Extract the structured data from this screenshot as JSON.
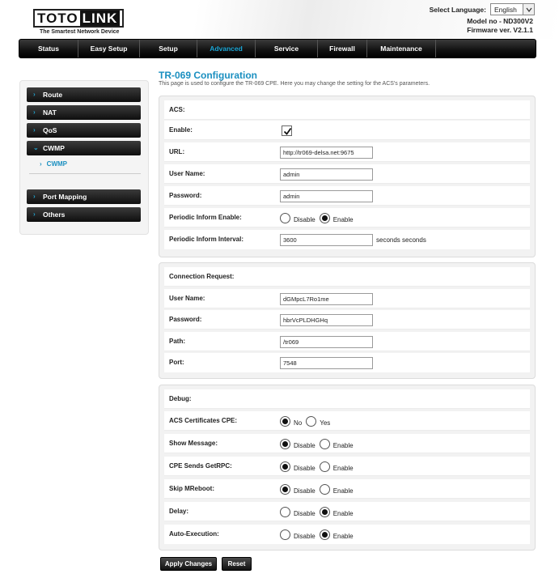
{
  "header": {
    "logo_left": "TOTO",
    "logo_right": "LINK",
    "tagline": "The Smartest Network Device",
    "language_label": "Select Language:",
    "language_value": "English",
    "model": "Model no - ND300V2",
    "firmware": "Firmware ver. V2.1.1"
  },
  "nav": {
    "items": [
      {
        "label": "Status"
      },
      {
        "label": "Easy Setup"
      },
      {
        "label": "Setup"
      },
      {
        "label": "Advanced"
      },
      {
        "label": "Service"
      },
      {
        "label": "Firewall"
      },
      {
        "label": "Maintenance"
      }
    ],
    "active": "Advanced"
  },
  "sidebar": {
    "items": [
      {
        "label": "Route"
      },
      {
        "label": "NAT"
      },
      {
        "label": "QoS"
      },
      {
        "label": "CWMP"
      },
      {
        "label": "Port Mapping"
      },
      {
        "label": "Others"
      }
    ],
    "sub_item": "CWMP"
  },
  "page": {
    "title": "TR-069 Configuration",
    "description": "This page is used to configure the TR-069 CPE. Here you may change the setting for the ACS's parameters."
  },
  "acs": {
    "heading": "ACS:",
    "enable_label": "Enable:",
    "enable_checked": true,
    "url_label": "URL:",
    "url_value": "http://tr069-delsa.net:9675",
    "username_label": "User Name:",
    "username_value": "admin",
    "password_label": "Password:",
    "password_value": "admin",
    "periodic_enable_label": "Periodic Inform Enable:",
    "periodic_disable": "Disable",
    "periodic_enable": "Enable",
    "periodic_selected": "Enable",
    "interval_label": "Periodic Inform Interval:",
    "interval_value": "3600",
    "interval_unit": "seconds seconds"
  },
  "connection": {
    "heading": "Connection Request:",
    "username_label": "User Name:",
    "username_value": "dGMpcL7Ro1me",
    "password_label": "Password:",
    "password_value": "hbrVcPLDHGHq",
    "path_label": "Path:",
    "path_value": "/tr069",
    "port_label": "Port:",
    "port_value": "7548"
  },
  "debug": {
    "heading": "Debug:",
    "rows": [
      {
        "label": "ACS Certificates CPE:",
        "opt1": "No",
        "opt2": "Yes",
        "selected": 1
      },
      {
        "label": "Show Message:",
        "opt1": "Disable",
        "opt2": "Enable",
        "selected": 1
      },
      {
        "label": "CPE Sends GetRPC:",
        "opt1": "Disable",
        "opt2": "Enable",
        "selected": 1
      },
      {
        "label": "Skip MReboot:",
        "opt1": "Disable",
        "opt2": "Enable",
        "selected": 1
      },
      {
        "label": "Delay:",
        "opt1": "Disable",
        "opt2": "Enable",
        "selected": 2
      },
      {
        "label": "Auto-Execution:",
        "opt1": "Disable",
        "opt2": "Enable",
        "selected": 2
      }
    ]
  },
  "buttons": {
    "apply": "Apply Changes",
    "reset": "Reset"
  }
}
